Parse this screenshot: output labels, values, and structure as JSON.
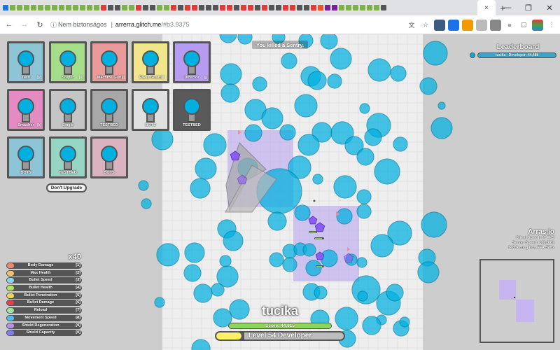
{
  "browser": {
    "new_tab_label": "+",
    "active_tab_close": "×",
    "window_controls": [
      "—",
      "❐",
      "✕"
    ],
    "security_label": "Nem biztonságos",
    "url_host": "arrerra.glitch.me",
    "url_path": "/#b3.9375"
  },
  "game": {
    "notification": "You killed a Sentry.",
    "dont_upgrade_label": "Don't Upgrade",
    "upgrades": [
      {
        "label": "Twin",
        "key": "[y]",
        "color": "#8ec5d6"
      },
      {
        "label": "Sniper",
        "key": "[u]",
        "color": "#a6dd8b"
      },
      {
        "label": "Machine Gun",
        "key": "[i]",
        "color": "#e99a9a"
      },
      {
        "label": "Flank Guard",
        "key": "[h]",
        "color": "#f1e68c"
      },
      {
        "label": "Director",
        "key": "[j]",
        "color": "#b59cf1"
      },
      {
        "label": "Smasher",
        "key": "[k]",
        "color": "#e48bc3"
      },
      {
        "label": "Single",
        "key": "",
        "color": "#c5c5c5"
      },
      {
        "label": "TESTBED",
        "key": "",
        "color": "#a8a8a8"
      },
      {
        "label": "BOTS",
        "key": "",
        "color": "#e0e0e0"
      },
      {
        "label": "TESTBED",
        "key": "",
        "color": "#5a5a5a"
      },
      {
        "label": "BOTS",
        "key": "",
        "color": "#8ec5d6"
      },
      {
        "label": "TESTBED",
        "key": "",
        "color": "#97d5c5"
      },
      {
        "label": "BOTS",
        "key": "",
        "color": "#d9b3bf"
      }
    ],
    "leaderboard": {
      "title": "Leaderboard",
      "entries": [
        {
          "text": "tucika - Developer: 44,488"
        }
      ]
    },
    "server": {
      "brand": "Arras.io",
      "lines": [
        "Client Speed: 67 FPS",
        "Server Speed: 100.00%",
        "143.9 ms  glitch-FFA  57Hz"
      ]
    },
    "skill_points": "x40",
    "skills": [
      {
        "name": "Body Damage",
        "key": "[1]",
        "color": "#e7896d"
      },
      {
        "name": "Max Health",
        "key": "[2]",
        "color": "#f1c26d"
      },
      {
        "name": "Bullet Speed",
        "key": "[3]",
        "color": "#8bd4f1"
      },
      {
        "name": "Bullet Health",
        "key": "[4]",
        "color": "#b6e06a"
      },
      {
        "name": "Bullet Penetration",
        "key": "[5]",
        "color": "#f0d35f"
      },
      {
        "name": "Bullet Damage",
        "key": "[6]",
        "color": "#e2434b"
      },
      {
        "name": "Reload",
        "key": "[7]",
        "color": "#a1e0a1"
      },
      {
        "name": "Movement Speed",
        "key": "[8]",
        "color": "#4fc0e8"
      },
      {
        "name": "Shield Regeneration",
        "key": "[9]",
        "color": "#b78ff0"
      },
      {
        "name": "Shield Capacity",
        "key": "[0]",
        "color": "#7f7fea"
      }
    ],
    "player": {
      "name": "tucika",
      "score_text": "Score: 44,815",
      "level_text": "Level 54 Developer",
      "level_progress": 0.2
    }
  }
}
